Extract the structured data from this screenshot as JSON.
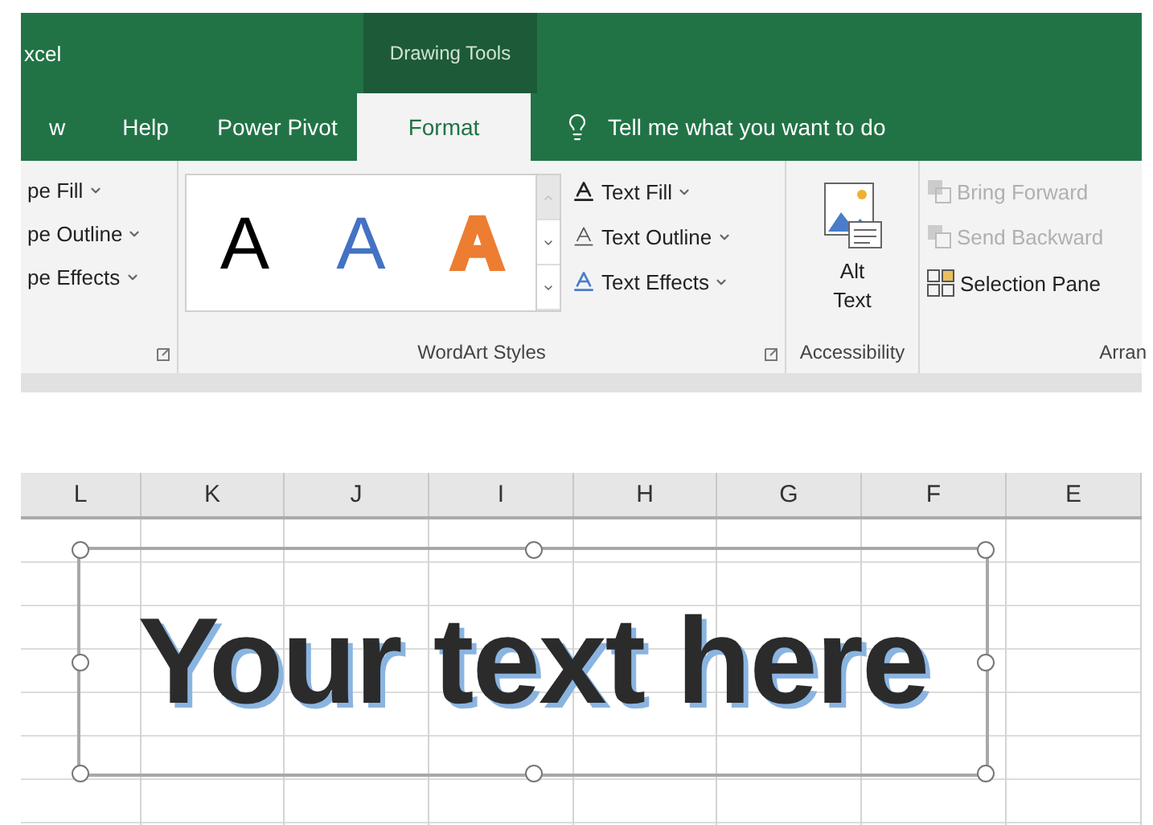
{
  "title_bar": {
    "app_title": "xcel",
    "contextual_group": "Drawing Tools"
  },
  "tabs": [
    {
      "label": "w",
      "selected": false
    },
    {
      "label": "Help",
      "selected": false
    },
    {
      "label": "Power Pivot",
      "selected": false
    },
    {
      "label": "Format",
      "selected": true
    }
  ],
  "tell_me": {
    "text": "Tell me what you want to do"
  },
  "ribbon": {
    "shape_styles": {
      "commands": [
        {
          "label": "pe Fill"
        },
        {
          "label": "pe Outline"
        },
        {
          "label": "pe Effects"
        }
      ]
    },
    "wordart_styles": {
      "label": "WordArt Styles",
      "gallery": [
        {
          "letter": "A",
          "kind": "filled",
          "color": "#000000"
        },
        {
          "letter": "A",
          "kind": "filled",
          "color": "#4472c4"
        },
        {
          "letter": "A",
          "kind": "outlined",
          "color": "#ed7d31"
        }
      ],
      "commands": [
        {
          "label": "Text Fill",
          "kind": "fill"
        },
        {
          "label": "Text Outline",
          "kind": "outline"
        },
        {
          "label": "Text Effects",
          "kind": "effects"
        }
      ]
    },
    "accessibility": {
      "label": "Accessibility",
      "button": "Alt Text"
    },
    "arrange": {
      "label": "Arran",
      "commands": [
        {
          "label": "Bring Forward",
          "kind": "bring",
          "disabled": true
        },
        {
          "label": "Send Backward",
          "kind": "send",
          "disabled": true
        },
        {
          "label": "Selection Pane",
          "kind": "pane",
          "disabled": false
        }
      ]
    }
  },
  "sheet": {
    "columns": [
      "L",
      "K",
      "J",
      "I",
      "H",
      "G",
      "F",
      "E"
    ],
    "text_box": {
      "text": "Your text here"
    }
  }
}
